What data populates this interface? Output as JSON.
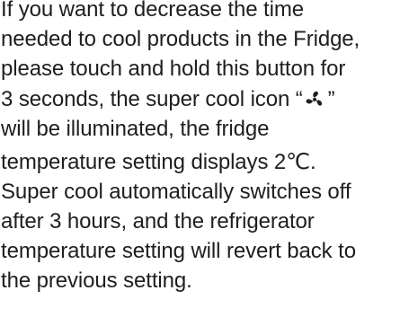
{
  "paragraph": {
    "lines": [
      "If you want to decrease the time",
      "needed to cool products in the Fridge,",
      "please touch and hold this button for",
      "3 seconds, the super cool icon “",
      "”",
      "will be illuminated, the fridge",
      "temperature setting displays 2℃.",
      "Super cool automatically switches off",
      "after 3 hours, and the refrigerator",
      "temperature setting will revert back to",
      "the previous setting."
    ]
  },
  "icons": {
    "super_cool": "fan-icon"
  }
}
